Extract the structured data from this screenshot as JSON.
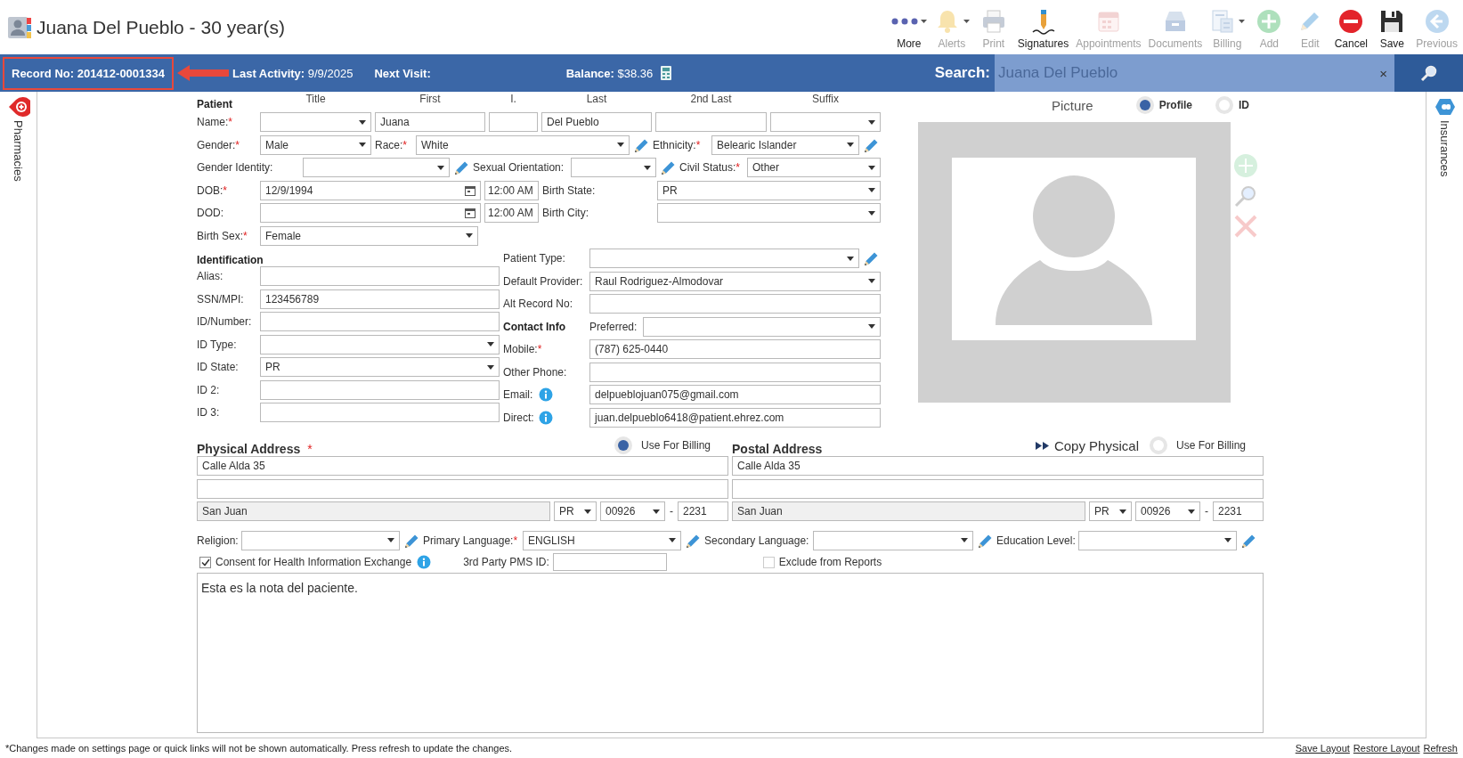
{
  "header": {
    "title": "Juana Del Pueblo - 30 year(s)"
  },
  "toolbar": [
    {
      "kind": "more",
      "label": "More",
      "disabled": false,
      "dropdown": true
    },
    {
      "kind": "alerts",
      "label": "Alerts",
      "disabled": true,
      "dropdown": true
    },
    {
      "kind": "print",
      "label": "Print",
      "disabled": true,
      "dropdown": false
    },
    {
      "kind": "signatures",
      "label": "Signatures",
      "disabled": false,
      "dropdown": false
    },
    {
      "kind": "appointments",
      "label": "Appointments",
      "disabled": true,
      "dropdown": false
    },
    {
      "kind": "documents",
      "label": "Documents",
      "disabled": true,
      "dropdown": false
    },
    {
      "kind": "billing",
      "label": "Billing",
      "disabled": true,
      "dropdown": true
    },
    {
      "kind": "add",
      "label": "Add",
      "disabled": true,
      "dropdown": false
    },
    {
      "kind": "edit",
      "label": "Edit",
      "disabled": true,
      "dropdown": false
    },
    {
      "kind": "cancel",
      "label": "Cancel",
      "disabled": false,
      "dropdown": false
    },
    {
      "kind": "save",
      "label": "Save",
      "disabled": false,
      "dropdown": false
    },
    {
      "kind": "previous",
      "label": "Previous",
      "disabled": true,
      "dropdown": false
    }
  ],
  "info_bar": {
    "record": "Record No: 201412-0001334",
    "record_highlighted": true,
    "last_activity": "**Last Activity:** 9/9/2025",
    "next_visit": "Next Visit:",
    "balance": "**Balance:** $38.36",
    "search_label": "Search:",
    "search_value": "Juana Del Pueblo",
    "clear": "×"
  },
  "left_tabs": [
    {
      "label": "Pharmacies"
    }
  ],
  "right_tabs": [
    {
      "label": "Insurances"
    }
  ],
  "patient": {
    "heading": "Patient",
    "columns": [
      "Title",
      "First",
      "I.",
      "Last",
      "2nd Last",
      "Suffix"
    ],
    "rows": [
      [
        {
          "kind": "label",
          "text": "Name:",
          "required": "*"
        },
        {
          "kind": "select"
        },
        {
          "kind": "text",
          "value": "Juana"
        },
        {
          "kind": "text"
        },
        {
          "kind": "text",
          "value": "Del Pueblo"
        },
        {
          "kind": "text"
        },
        {
          "kind": "select"
        }
      ],
      [
        {
          "kind": "label",
          "text": "Gender:",
          "required": "*"
        },
        {
          "kind": "select",
          "value": "Male"
        },
        {
          "kind": "label",
          "text": "Race:",
          "required": "*"
        },
        {
          "kind": "select",
          "value": "White"
        },
        {
          "kind": "pencil"
        },
        {
          "kind": "label",
          "text": "Ethnicity:",
          "required": "*"
        },
        {
          "kind": "select",
          "value": "Belearic Islander"
        },
        {
          "kind": "pencil"
        }
      ],
      [
        {
          "kind": "label",
          "text": "Gender Identity:"
        },
        {
          "kind": "select"
        },
        {
          "kind": "pencil"
        },
        {
          "kind": "label",
          "text": "Sexual Orientation:"
        },
        {
          "kind": "select"
        },
        {
          "kind": "pencil"
        },
        {
          "kind": "label",
          "text": "Civil Status:",
          "required": "*"
        },
        {
          "kind": "select",
          "value": "Other"
        }
      ],
      [
        {
          "kind": "label",
          "text": "DOB:",
          "required": "*"
        },
        {
          "kind": "date",
          "value": "12/9/1994"
        },
        {
          "kind": "time",
          "value": "12:00 AM"
        },
        {
          "kind": "label",
          "text": "Birth State:"
        },
        {
          "kind": "select",
          "value": "PR"
        }
      ],
      [
        {
          "kind": "label",
          "text": "DOD:"
        },
        {
          "kind": "date"
        },
        {
          "kind": "time",
          "value": "12:00 AM"
        },
        {
          "kind": "label",
          "text": "Birth City:"
        },
        {
          "kind": "select"
        }
      ],
      [
        {
          "kind": "label",
          "text": "Birth Sex:",
          "required": "*"
        },
        {
          "kind": "select",
          "value": "Female"
        }
      ]
    ]
  },
  "identification": {
    "heading": "Identification",
    "rows": [
      [
        {
          "kind": "label",
          "text": "Alias:"
        },
        {
          "kind": "text"
        }
      ],
      [
        {
          "kind": "label",
          "text": "SSN/MPI:"
        },
        {
          "kind": "text",
          "value": "123456789"
        }
      ],
      [
        {
          "kind": "label",
          "text": "ID/Number:"
        },
        {
          "kind": "text"
        }
      ],
      [
        {
          "kind": "label",
          "text": "ID Type:"
        },
        {
          "kind": "select"
        }
      ],
      [
        {
          "kind": "label",
          "text": "ID State:"
        },
        {
          "kind": "select",
          "value": "PR"
        }
      ],
      [
        {
          "kind": "label",
          "text": "ID 2:"
        },
        {
          "kind": "text"
        }
      ],
      [
        {
          "kind": "label",
          "text": "ID 3:"
        },
        {
          "kind": "text"
        }
      ]
    ]
  },
  "details": {
    "rows": [
      [
        {
          "kind": "label",
          "text": "Patient Type:"
        },
        {
          "kind": "select"
        },
        {
          "kind": "pencil"
        }
      ],
      [
        {
          "kind": "label",
          "text": "Default Provider:"
        },
        {
          "kind": "select",
          "value": "Raul Rodriguez-Almodovar"
        }
      ],
      [
        {
          "kind": "label",
          "text": "Alt Record No:"
        },
        {
          "kind": "text"
        }
      ],
      [
        {
          "kind": "heading",
          "text": "Contact Info"
        },
        {
          "kind": "label",
          "text": "Preferred:"
        },
        {
          "kind": "select"
        }
      ],
      [
        {
          "kind": "label",
          "text": "Mobile:",
          "required": "*"
        },
        {
          "kind": "text",
          "value": "(787) 625-0440"
        }
      ],
      [
        {
          "kind": "label",
          "text": "Other Phone:"
        },
        {
          "kind": "text"
        }
      ],
      [
        {
          "kind": "label",
          "text": "Email:"
        },
        {
          "kind": "info"
        },
        {
          "kind": "text",
          "value": "delpueblojuan075@gmail.com"
        }
      ],
      [
        {
          "kind": "label",
          "text": "Direct:"
        },
        {
          "kind": "info"
        },
        {
          "kind": "text",
          "value": "juan.delpueblo6418@patient.ehrez.com"
        }
      ]
    ]
  },
  "picture": {
    "title": "Picture",
    "options": [
      {
        "label": "Profile",
        "selected": true
      },
      {
        "label": "ID",
        "selected": false
      }
    ]
  },
  "addresses": [
    {
      "title": "Physical Address",
      "required": "*",
      "billing": {
        "label": "Use For Billing",
        "selected": true
      },
      "rows": [
        [
          {
            "kind": "text",
            "value": "Calle Alda 35"
          }
        ],
        [
          {
            "kind": "text"
          }
        ],
        [
          {
            "kind": "readonly",
            "value": "San Juan"
          },
          {
            "kind": "select",
            "value": "PR"
          },
          {
            "kind": "select",
            "value": "00926"
          },
          {
            "kind": "dash",
            "text": "-"
          },
          {
            "kind": "text",
            "value": "2231"
          }
        ]
      ]
    },
    {
      "title": "Postal Address",
      "copy": "Copy Physical",
      "billing": {
        "label": "Use For Billing",
        "selected": false
      },
      "rows": [
        [
          {
            "kind": "text",
            "value": "Calle Alda 35"
          }
        ],
        [
          {
            "kind": "text"
          }
        ],
        [
          {
            "kind": "readonly",
            "value": "San Juan"
          },
          {
            "kind": "select",
            "value": "PR"
          },
          {
            "kind": "select",
            "value": "00926"
          },
          {
            "kind": "dash",
            "text": "-"
          },
          {
            "kind": "text",
            "value": "2231"
          }
        ]
      ]
    }
  ],
  "preferences": [
    {
      "kind": "label",
      "text": "Religion:"
    },
    {
      "kind": "select"
    },
    {
      "kind": "pencil"
    },
    {
      "kind": "label",
      "text": "Primary Language:",
      "required": "*"
    },
    {
      "kind": "select",
      "value": "ENGLISH"
    },
    {
      "kind": "pencil"
    },
    {
      "kind": "label",
      "text": "Secondary Language:"
    },
    {
      "kind": "select"
    },
    {
      "kind": "pencil"
    },
    {
      "kind": "label",
      "text": "Education Level:"
    },
    {
      "kind": "select"
    },
    {
      "kind": "pencil"
    }
  ],
  "flags": [
    {
      "kind": "checkbox",
      "label": "Consent for Health Information Exchange",
      "checked": true
    },
    {
      "kind": "info"
    },
    {
      "kind": "label",
      "text": "3rd Party PMS ID:"
    },
    {
      "kind": "text"
    },
    {
      "kind": "checkbox",
      "label": "Exclude from Reports",
      "checked": false
    }
  ],
  "notes": "Esta es la nota del paciente.",
  "footer": {
    "note": "*Changes made on settings page or quick links will not be shown automatically. Press refresh to update the changes.",
    "links": [
      "Save Layout",
      "Restore Layout",
      "Refresh"
    ]
  }
}
